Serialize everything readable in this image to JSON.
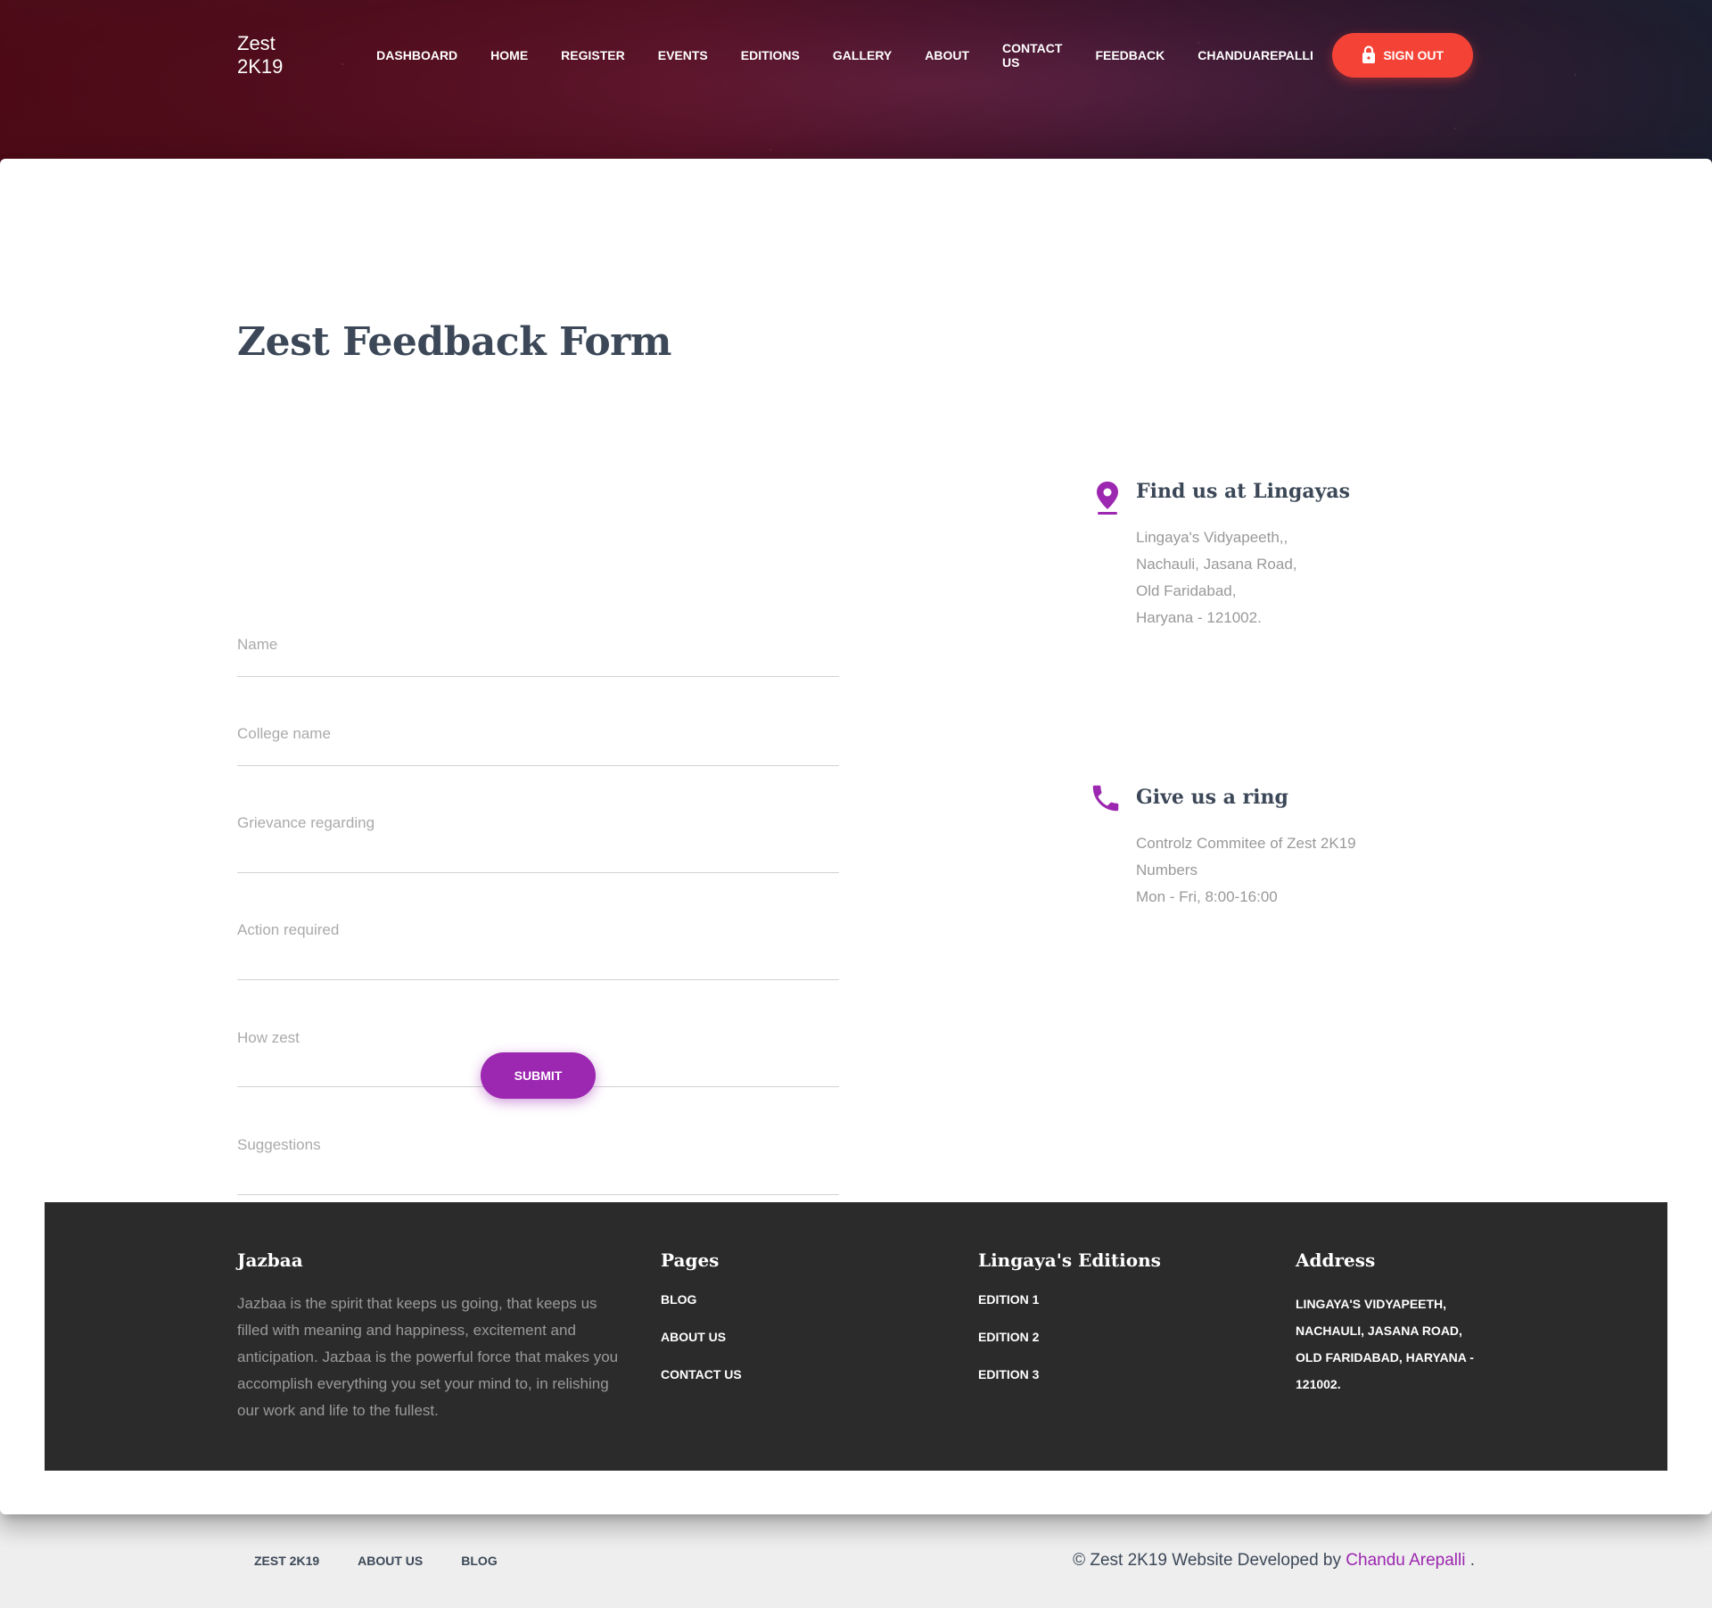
{
  "colors": {
    "primary": "#9c27b0",
    "danger": "#f44336",
    "title": "#3c4858",
    "footer_bg": "#2b2b2b"
  },
  "nav": {
    "brand": "Zest 2K19",
    "links": [
      "DASHBOARD",
      "HOME",
      "REGISTER",
      "EVENTS",
      "EDITIONS",
      "GALLERY",
      "ABOUT",
      "CONTACT US",
      "FEEDBACK",
      "CHANDUAREPALLI"
    ],
    "signout_label": "SIGN OUT",
    "signout_icon": "lock-icon"
  },
  "page": {
    "title": "Zest Feedback Form"
  },
  "form": {
    "fields": [
      {
        "label": "Name"
      },
      {
        "label": "College name"
      },
      {
        "label": "Grievance regarding"
      },
      {
        "label": "Action required"
      },
      {
        "label": "How zest"
      },
      {
        "label": "Suggestions"
      }
    ],
    "submit_label": "SUBMIT"
  },
  "contact": {
    "location": {
      "icon": "map-pin-icon",
      "title": "Find us at Lingayas",
      "lines": [
        "Lingaya's Vidyapeeth,,",
        "Nachauli, Jasana Road,",
        "Old Faridabad,",
        "Haryana - 121002."
      ]
    },
    "phone": {
      "icon": "phone-icon",
      "title": "Give us a ring",
      "lines": [
        "Controlz Commitee of Zest 2K19",
        "Numbers",
        "Mon - Fri, 8:00-16:00"
      ]
    }
  },
  "footer": {
    "about": {
      "title": "Jazbaa",
      "text": "Jazbaa is the spirit that keeps us going, that keeps us filled with meaning and happiness, excitement and anticipation. Jazbaa is the powerful force that makes you accomplish everything you set your mind to, in relishing our work and life to the fullest."
    },
    "pages": {
      "title": "Pages",
      "links": [
        "BLOG",
        "ABOUT US",
        "CONTACT US"
      ]
    },
    "editions": {
      "title": "Lingaya's Editions",
      "links": [
        "EDITION 1",
        "EDITION 2",
        "EDITION 3"
      ]
    },
    "address": {
      "title": "Address",
      "text": "LINGAYA'S VIDYAPEETH, NACHAULI, JASANA ROAD, OLD FARIDABAD, HARYANA - 121002."
    }
  },
  "bottom": {
    "links": [
      "ZEST 2K19",
      "ABOUT US",
      "BLOG"
    ],
    "copyright_prefix": "© Zest 2K19 Website Developed by ",
    "author": "Chandu Arepalli",
    "copyright_suffix": " ."
  }
}
